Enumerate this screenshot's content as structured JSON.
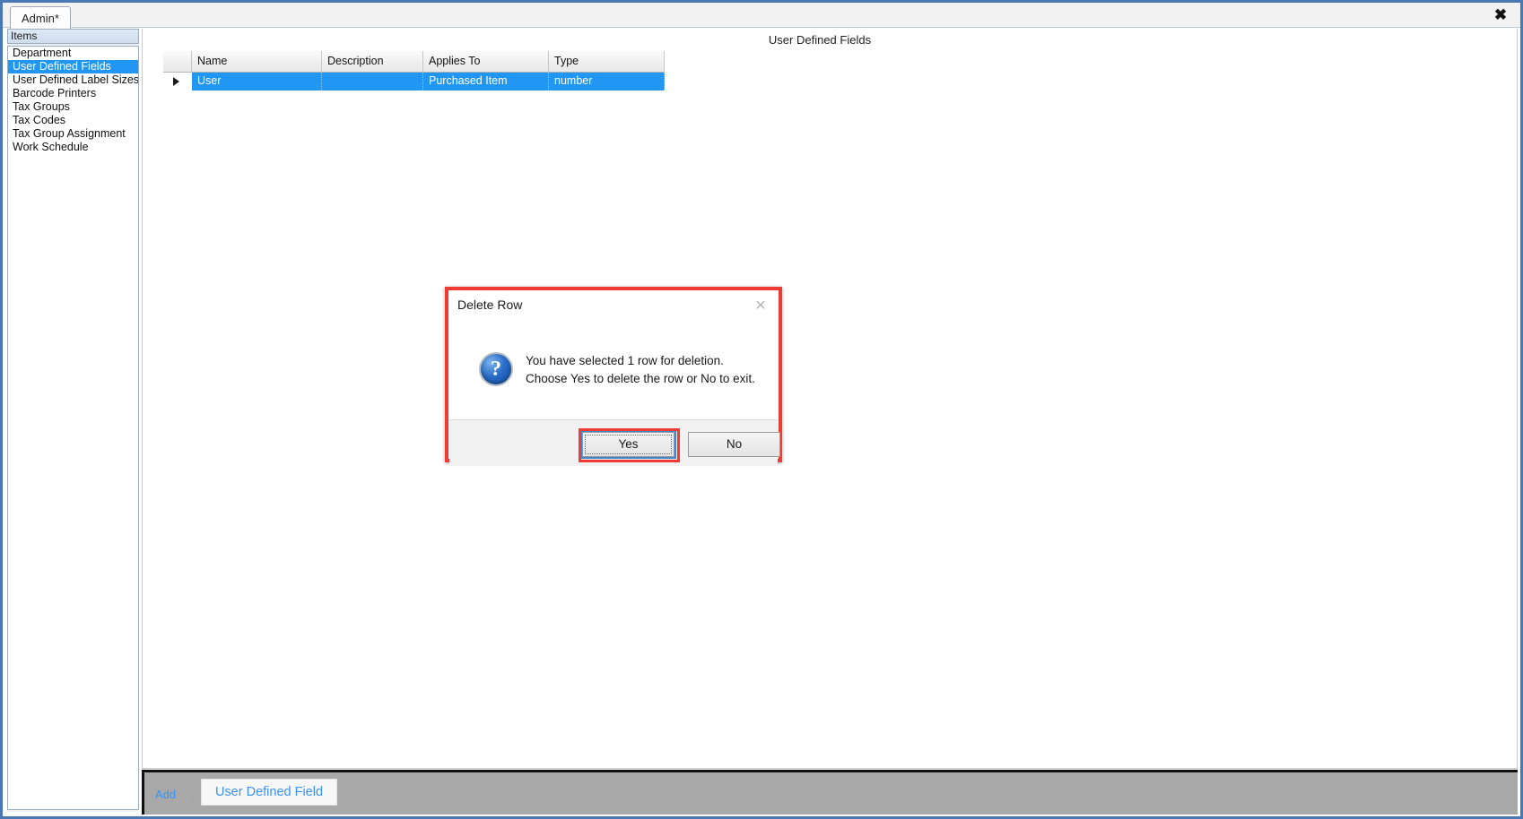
{
  "window": {
    "close_icon": "close-x-icon"
  },
  "tabstrip": {
    "tabs": [
      {
        "label": "Admin",
        "modified_marker": "*"
      }
    ]
  },
  "sidebar": {
    "header": "Items",
    "items": [
      {
        "label": "Department",
        "selected": false
      },
      {
        "label": "User Defined Fields",
        "selected": true
      },
      {
        "label": "User Defined Label Sizes",
        "selected": false
      },
      {
        "label": "Barcode Printers",
        "selected": false
      },
      {
        "label": "Tax Groups",
        "selected": false
      },
      {
        "label": "Tax Codes",
        "selected": false
      },
      {
        "label": "Tax Group Assignment",
        "selected": false
      },
      {
        "label": "Work Schedule",
        "selected": false
      }
    ]
  },
  "content": {
    "title": "User Defined Fields",
    "grid": {
      "columns": [
        "Name",
        "Description",
        "Applies To",
        "Type"
      ],
      "rows": [
        {
          "selected": true,
          "indicator": "row-selector-arrow",
          "Name": "User",
          "Description": "",
          "Applies To": "Purchased Item",
          "Type": "number"
        }
      ]
    }
  },
  "bottom_toolbar": {
    "add_label": "Add",
    "add_dots": "...",
    "buttons": [
      {
        "label": "User Defined Field"
      }
    ]
  },
  "dialog": {
    "title": "Delete Row",
    "close_icon": "dialog-close-icon",
    "icon": "question-mark-icon",
    "message_line1": "You have selected 1 row for deletion.",
    "message_line2": "Choose Yes to delete the row or No to exit.",
    "buttons": {
      "yes": "Yes",
      "no": "No"
    },
    "focused_button": "Yes"
  },
  "colors": {
    "selection_blue": "#2196f3",
    "highlight_red": "#ee3b33",
    "focus_blue": "#3f86cf",
    "toolbar_gray": "#a8a8a8",
    "link_blue": "#3a93f5",
    "frame_blue": "#4a78b5"
  }
}
